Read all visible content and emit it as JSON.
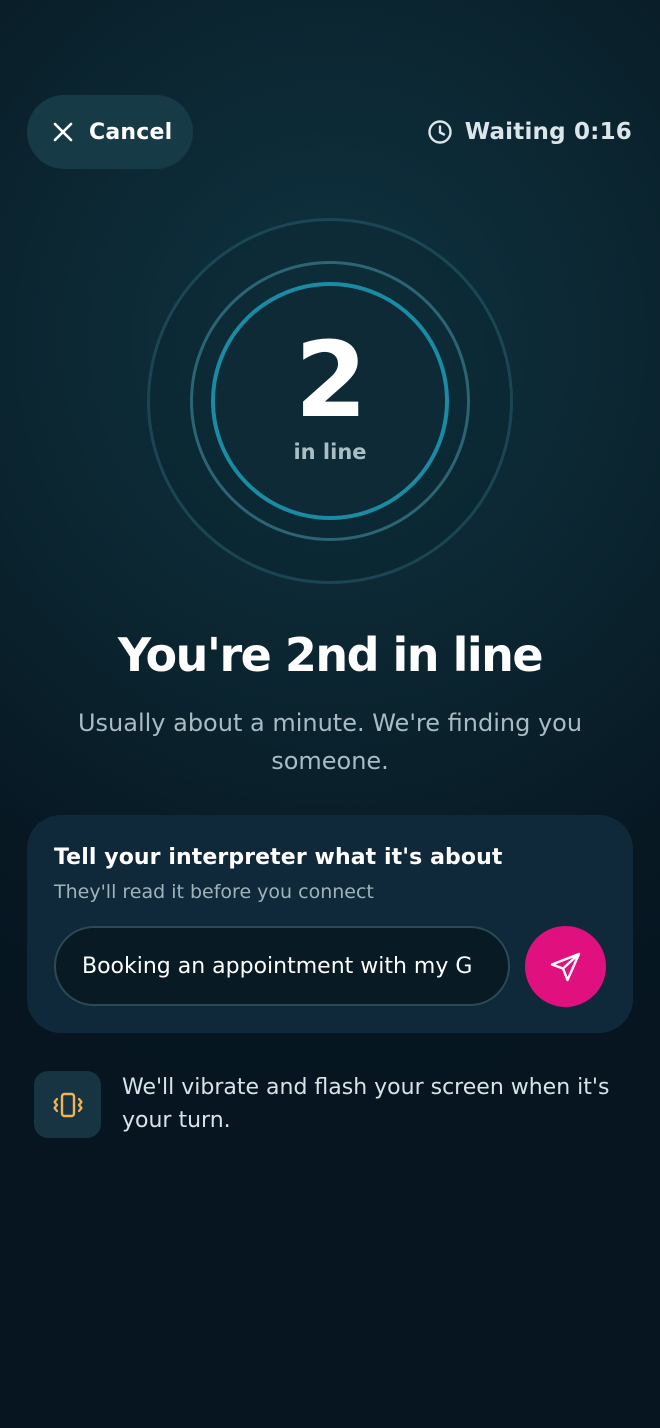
{
  "header": {
    "cancel_label": "Cancel",
    "waiting_label": "Waiting 0:16"
  },
  "queue": {
    "position": "2",
    "caption": "in line"
  },
  "status": {
    "headline": "You're 2nd in line",
    "subline": "Usually about a minute. We're finding you someone."
  },
  "context_card": {
    "title": "Tell your interpreter what it's about",
    "subtitle": "They'll read it before you connect",
    "input_value": "Booking an appointment with my G"
  },
  "notice": {
    "text": "We'll vibrate and flash your screen when it's your turn."
  },
  "colors": {
    "accent_pink": "#e0107f",
    "ring_teal": "#1b8ba3",
    "vibrate_icon": "#f0b455"
  },
  "icons": {
    "cancel": "close-icon",
    "waiting": "clock-icon",
    "send": "send-icon",
    "notice": "vibrate-icon"
  }
}
